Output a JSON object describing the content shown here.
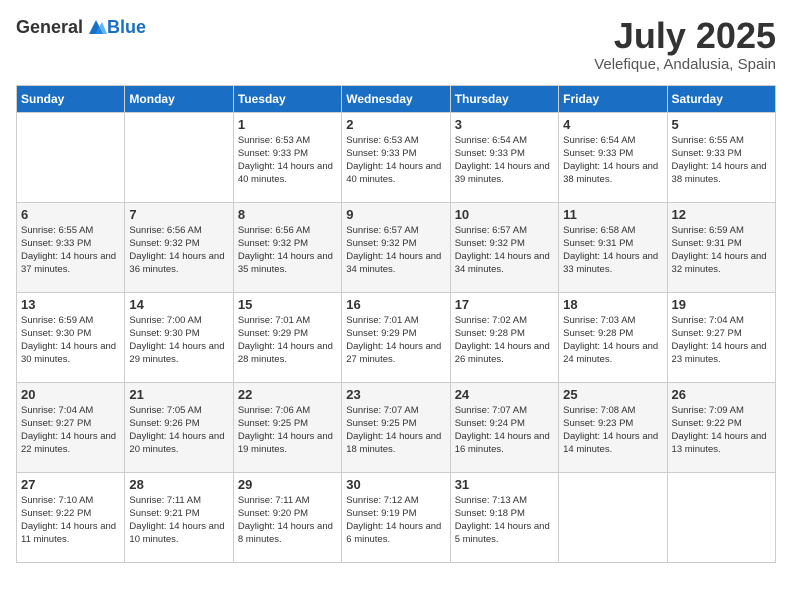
{
  "header": {
    "logo_general": "General",
    "logo_blue": "Blue",
    "month_year": "July 2025",
    "location": "Velefique, Andalusia, Spain"
  },
  "days_of_week": [
    "Sunday",
    "Monday",
    "Tuesday",
    "Wednesday",
    "Thursday",
    "Friday",
    "Saturday"
  ],
  "weeks": [
    [
      {
        "day": "",
        "sunrise": "",
        "sunset": "",
        "daylight": ""
      },
      {
        "day": "",
        "sunrise": "",
        "sunset": "",
        "daylight": ""
      },
      {
        "day": "1",
        "sunrise": "Sunrise: 6:53 AM",
        "sunset": "Sunset: 9:33 PM",
        "daylight": "Daylight: 14 hours and 40 minutes."
      },
      {
        "day": "2",
        "sunrise": "Sunrise: 6:53 AM",
        "sunset": "Sunset: 9:33 PM",
        "daylight": "Daylight: 14 hours and 40 minutes."
      },
      {
        "day": "3",
        "sunrise": "Sunrise: 6:54 AM",
        "sunset": "Sunset: 9:33 PM",
        "daylight": "Daylight: 14 hours and 39 minutes."
      },
      {
        "day": "4",
        "sunrise": "Sunrise: 6:54 AM",
        "sunset": "Sunset: 9:33 PM",
        "daylight": "Daylight: 14 hours and 38 minutes."
      },
      {
        "day": "5",
        "sunrise": "Sunrise: 6:55 AM",
        "sunset": "Sunset: 9:33 PM",
        "daylight": "Daylight: 14 hours and 38 minutes."
      }
    ],
    [
      {
        "day": "6",
        "sunrise": "Sunrise: 6:55 AM",
        "sunset": "Sunset: 9:33 PM",
        "daylight": "Daylight: 14 hours and 37 minutes."
      },
      {
        "day": "7",
        "sunrise": "Sunrise: 6:56 AM",
        "sunset": "Sunset: 9:32 PM",
        "daylight": "Daylight: 14 hours and 36 minutes."
      },
      {
        "day": "8",
        "sunrise": "Sunrise: 6:56 AM",
        "sunset": "Sunset: 9:32 PM",
        "daylight": "Daylight: 14 hours and 35 minutes."
      },
      {
        "day": "9",
        "sunrise": "Sunrise: 6:57 AM",
        "sunset": "Sunset: 9:32 PM",
        "daylight": "Daylight: 14 hours and 34 minutes."
      },
      {
        "day": "10",
        "sunrise": "Sunrise: 6:57 AM",
        "sunset": "Sunset: 9:32 PM",
        "daylight": "Daylight: 14 hours and 34 minutes."
      },
      {
        "day": "11",
        "sunrise": "Sunrise: 6:58 AM",
        "sunset": "Sunset: 9:31 PM",
        "daylight": "Daylight: 14 hours and 33 minutes."
      },
      {
        "day": "12",
        "sunrise": "Sunrise: 6:59 AM",
        "sunset": "Sunset: 9:31 PM",
        "daylight": "Daylight: 14 hours and 32 minutes."
      }
    ],
    [
      {
        "day": "13",
        "sunrise": "Sunrise: 6:59 AM",
        "sunset": "Sunset: 9:30 PM",
        "daylight": "Daylight: 14 hours and 30 minutes."
      },
      {
        "day": "14",
        "sunrise": "Sunrise: 7:00 AM",
        "sunset": "Sunset: 9:30 PM",
        "daylight": "Daylight: 14 hours and 29 minutes."
      },
      {
        "day": "15",
        "sunrise": "Sunrise: 7:01 AM",
        "sunset": "Sunset: 9:29 PM",
        "daylight": "Daylight: 14 hours and 28 minutes."
      },
      {
        "day": "16",
        "sunrise": "Sunrise: 7:01 AM",
        "sunset": "Sunset: 9:29 PM",
        "daylight": "Daylight: 14 hours and 27 minutes."
      },
      {
        "day": "17",
        "sunrise": "Sunrise: 7:02 AM",
        "sunset": "Sunset: 9:28 PM",
        "daylight": "Daylight: 14 hours and 26 minutes."
      },
      {
        "day": "18",
        "sunrise": "Sunrise: 7:03 AM",
        "sunset": "Sunset: 9:28 PM",
        "daylight": "Daylight: 14 hours and 24 minutes."
      },
      {
        "day": "19",
        "sunrise": "Sunrise: 7:04 AM",
        "sunset": "Sunset: 9:27 PM",
        "daylight": "Daylight: 14 hours and 23 minutes."
      }
    ],
    [
      {
        "day": "20",
        "sunrise": "Sunrise: 7:04 AM",
        "sunset": "Sunset: 9:27 PM",
        "daylight": "Daylight: 14 hours and 22 minutes."
      },
      {
        "day": "21",
        "sunrise": "Sunrise: 7:05 AM",
        "sunset": "Sunset: 9:26 PM",
        "daylight": "Daylight: 14 hours and 20 minutes."
      },
      {
        "day": "22",
        "sunrise": "Sunrise: 7:06 AM",
        "sunset": "Sunset: 9:25 PM",
        "daylight": "Daylight: 14 hours and 19 minutes."
      },
      {
        "day": "23",
        "sunrise": "Sunrise: 7:07 AM",
        "sunset": "Sunset: 9:25 PM",
        "daylight": "Daylight: 14 hours and 18 minutes."
      },
      {
        "day": "24",
        "sunrise": "Sunrise: 7:07 AM",
        "sunset": "Sunset: 9:24 PM",
        "daylight": "Daylight: 14 hours and 16 minutes."
      },
      {
        "day": "25",
        "sunrise": "Sunrise: 7:08 AM",
        "sunset": "Sunset: 9:23 PM",
        "daylight": "Daylight: 14 hours and 14 minutes."
      },
      {
        "day": "26",
        "sunrise": "Sunrise: 7:09 AM",
        "sunset": "Sunset: 9:22 PM",
        "daylight": "Daylight: 14 hours and 13 minutes."
      }
    ],
    [
      {
        "day": "27",
        "sunrise": "Sunrise: 7:10 AM",
        "sunset": "Sunset: 9:22 PM",
        "daylight": "Daylight: 14 hours and 11 minutes."
      },
      {
        "day": "28",
        "sunrise": "Sunrise: 7:11 AM",
        "sunset": "Sunset: 9:21 PM",
        "daylight": "Daylight: 14 hours and 10 minutes."
      },
      {
        "day": "29",
        "sunrise": "Sunrise: 7:11 AM",
        "sunset": "Sunset: 9:20 PM",
        "daylight": "Daylight: 14 hours and 8 minutes."
      },
      {
        "day": "30",
        "sunrise": "Sunrise: 7:12 AM",
        "sunset": "Sunset: 9:19 PM",
        "daylight": "Daylight: 14 hours and 6 minutes."
      },
      {
        "day": "31",
        "sunrise": "Sunrise: 7:13 AM",
        "sunset": "Sunset: 9:18 PM",
        "daylight": "Daylight: 14 hours and 5 minutes."
      },
      {
        "day": "",
        "sunrise": "",
        "sunset": "",
        "daylight": ""
      },
      {
        "day": "",
        "sunrise": "",
        "sunset": "",
        "daylight": ""
      }
    ]
  ]
}
